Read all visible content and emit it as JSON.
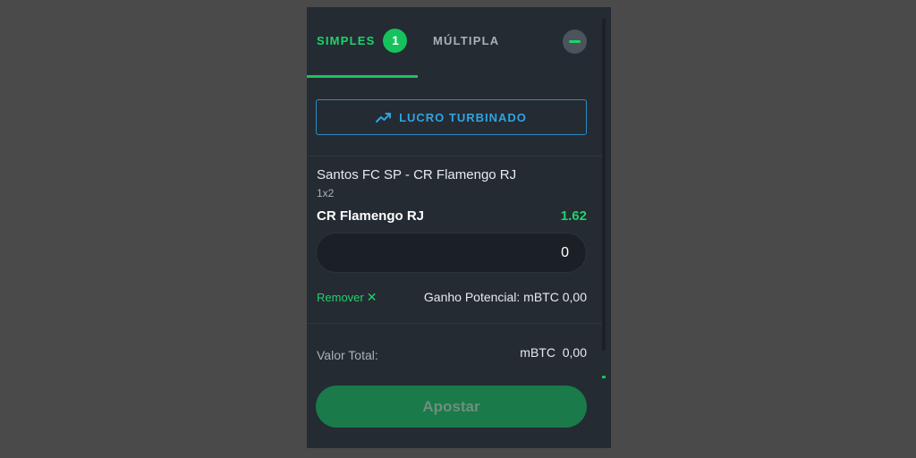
{
  "tabs": {
    "simples_label": "SIMPLES",
    "simples_count": "1",
    "multipla_label": "MÚLTIPLA"
  },
  "icons": {
    "collapse": "minus-icon",
    "boost": "trending-up-icon",
    "remove": "close-icon"
  },
  "boost": {
    "label": "LUCRO TURBINADO"
  },
  "selection": {
    "event": "Santos FC SP - CR Flamengo RJ",
    "market": "1x2",
    "pick": "CR Flamengo RJ",
    "odds": "1.62",
    "stake_value": "0",
    "remove_label": "Remover",
    "remove_icon_glyph": "✕",
    "potential_label": "Ganho Potencial: mBTC 0,00"
  },
  "summary": {
    "total_label": "Valor Total:",
    "total_value": "mBTC  0,00"
  },
  "actions": {
    "bet_label": "Apostar"
  },
  "colors": {
    "page_bg": "#4a4a4a",
    "panel_bg": "#242b33",
    "accent_green": "#1fd36a",
    "boost_blue": "#2fa4e2",
    "bet_button": "#1a7a4a"
  }
}
